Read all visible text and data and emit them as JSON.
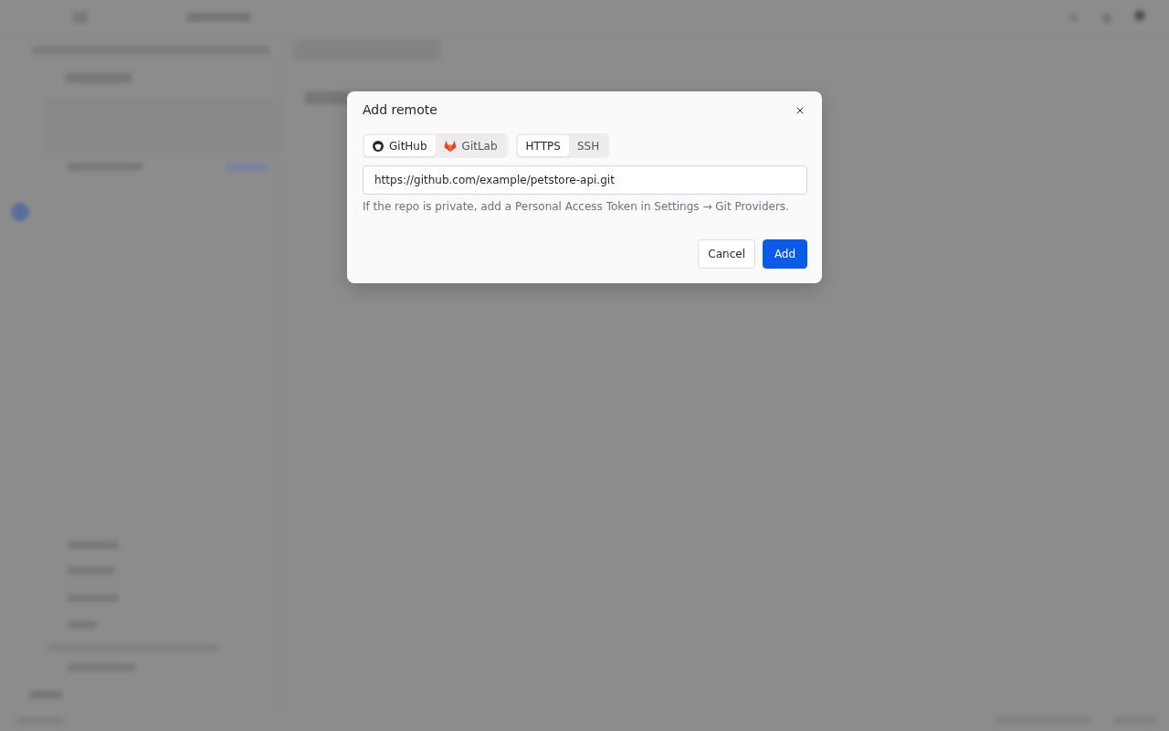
{
  "dialog": {
    "title": "Add remote",
    "providers": [
      {
        "label": "GitHub",
        "kind": "github",
        "selected": true
      },
      {
        "label": "GitLab",
        "kind": "gitlab",
        "selected": false
      }
    ],
    "protocols": [
      {
        "label": "HTTPS",
        "selected": true
      },
      {
        "label": "SSH",
        "selected": false
      }
    ],
    "url_field": {
      "value": "https://github.com/example/petstore-api.git"
    },
    "hint": "If the repo is private, add a Personal Access Token in Settings → Git Providers.",
    "buttons": [
      {
        "label": "Cancel",
        "kind": "secondary"
      },
      {
        "label": "Add",
        "kind": "primary"
      }
    ]
  }
}
